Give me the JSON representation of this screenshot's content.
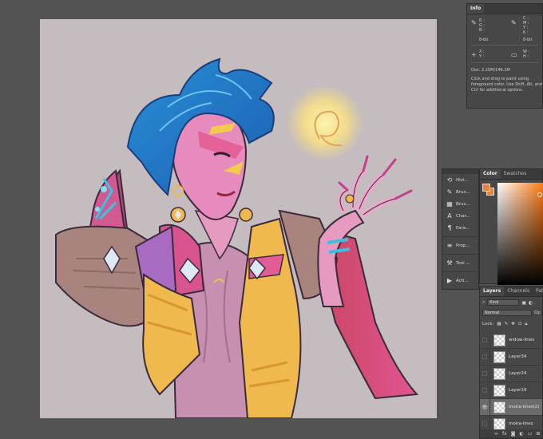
{
  "info_panel": {
    "tab": "Info",
    "rgb_labels": [
      "R :",
      "G :",
      "B :"
    ],
    "cmyk_labels": [
      "C :",
      "M :",
      "Y :",
      "K :"
    ],
    "bitdepth_left": "8-bit",
    "bitdepth_right": "8-bit",
    "xy_labels": [
      "X :",
      "Y :"
    ],
    "wh_labels": [
      "W :",
      "H :"
    ],
    "doc": "Doc: 3.15M/146.1M",
    "hint": "Click and drag to paint using foreground color. Use Shift, Alt, and Ctrl for additional options."
  },
  "tool_strip": {
    "items": [
      {
        "label": "Hist...",
        "icon": "history-icon"
      },
      {
        "label": "Brus...",
        "icon": "brush-icon"
      },
      {
        "label": "Brus...",
        "icon": "brush-presets-icon"
      },
      {
        "label": "Char...",
        "icon": "character-icon"
      },
      {
        "label": "Para...",
        "icon": "paragraph-icon"
      },
      {
        "label": "Prop...",
        "icon": "properties-icon"
      },
      {
        "label": "Tool ...",
        "icon": "tool-presets-icon"
      },
      {
        "label": "Acti...",
        "icon": "actions-icon"
      }
    ]
  },
  "color_panel": {
    "tabs": [
      "Color",
      "Swatches"
    ],
    "foreground": "#e9843a",
    "background": "#e9843a"
  },
  "layers_panel": {
    "tabs": [
      "Layers",
      "Channels",
      "Paths"
    ],
    "filter": "Kind",
    "blend_mode": "Normal",
    "opacity_abbr": "Op",
    "lock_label": "Lock:",
    "layers": [
      {
        "name": "widow-lines",
        "visible": false,
        "selected": false
      },
      {
        "name": "Layer34",
        "visible": false,
        "selected": false
      },
      {
        "name": "Layer24",
        "visible": false,
        "selected": false
      },
      {
        "name": "Layer19",
        "visible": false,
        "selected": false
      },
      {
        "name": "moira-lines(2)",
        "visible": true,
        "selected": true
      },
      {
        "name": "moira-lines",
        "visible": false,
        "selected": false
      }
    ],
    "footer_icons": [
      "link-icon",
      "fx-icon",
      "mask-icon",
      "adjustment-icon",
      "group-icon",
      "new-layer-icon",
      "trash-icon"
    ]
  }
}
